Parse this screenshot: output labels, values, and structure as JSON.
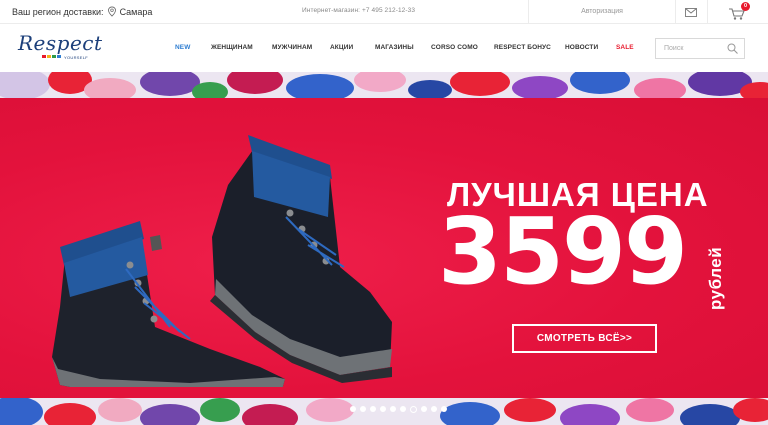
{
  "topbar": {
    "region_label": "Ваш регион доставки:",
    "region_city": "Самара",
    "shop_phone": "Интернет-магазин: +7 495 212-12-33",
    "auth_label": "Авторизация",
    "cart_count": "0"
  },
  "header": {
    "logo_text": "Respect",
    "logo_sub": "YOURSELF",
    "nav": [
      {
        "label": "NEW"
      },
      {
        "label": "ЖЕНЩИНАМ"
      },
      {
        "label": "МУЖЧИНАМ"
      },
      {
        "label": "АКЦИИ"
      },
      {
        "label": "МАГАЗИНЫ"
      },
      {
        "label": "CORSO COMO"
      },
      {
        "label": "RESPECT БОНУС"
      },
      {
        "label": "НОВОСТИ"
      },
      {
        "label": "SALE"
      }
    ],
    "search_placeholder": "Поиск"
  },
  "banner": {
    "headline": "ЛУЧШАЯ ЦЕНА",
    "price": "3599",
    "currency": "рублей",
    "cta_label": "СМОТРЕТЬ ВСЁ>>",
    "slides_count": 10,
    "active_slide": 7
  },
  "colors": {
    "accent_red": "#e6133f",
    "brand_blue": "#1c3f7a",
    "new_blue": "#2e7dd1",
    "sale_red": "#e8192c"
  }
}
